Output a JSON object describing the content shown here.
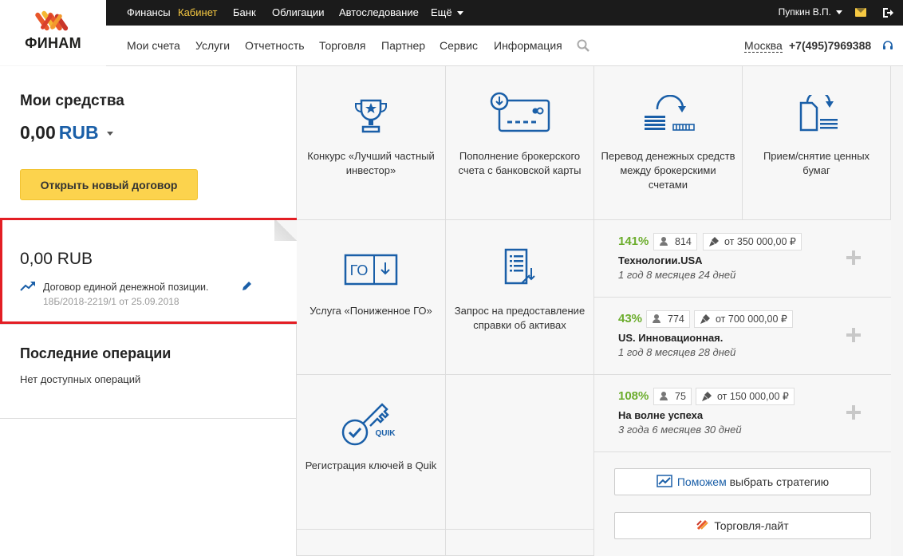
{
  "logo": {
    "text": "ФИНАМ"
  },
  "topbar": {
    "items": [
      "Финансы",
      "Кабинет",
      "Банк",
      "Облигации",
      "Автоследование",
      "Ещё"
    ],
    "user": "Пупкин В.П."
  },
  "mainnav": {
    "items": [
      "Мои счета",
      "Услуги",
      "Отчетность",
      "Торговля",
      "Партнер",
      "Сервис",
      "Информация"
    ],
    "city": "Москва",
    "phone": "+7(495)7969388"
  },
  "funds": {
    "title": "Мои средства",
    "amount": "0,00",
    "currency": "RUB",
    "open_button": "Открыть новый договор"
  },
  "contract": {
    "amount": "0,00 RUB",
    "name": "Договор единой денежной позиции.",
    "number": "18Б/2018-2219/1 от 25.09.2018"
  },
  "operations": {
    "title": "Последние операции",
    "empty": "Нет доступных операций"
  },
  "tiles": {
    "contest": "Конкурс «Лучший частный инвестор»",
    "topup": "Пополнение брокерского счета с банковской карты",
    "transfer": "Перевод денежных средств между брокерскими счетами",
    "securities": "Прием/снятие ценных бумаг",
    "go": "Услуга «Пониженное ГО»",
    "report": "Запрос на предоставление справки об активах",
    "quik": "Регистрация ключей в Quik",
    "go_icon_text": "ГО",
    "quik_icon_text": "QUIK"
  },
  "strategies": [
    {
      "pct": "141%",
      "users": "814",
      "min": "от 350 000,00 ₽",
      "name": "Технологии.USA",
      "duration": "1 год 8 месяцев 24 дней"
    },
    {
      "pct": "43%",
      "users": "774",
      "min": "от 700 000,00 ₽",
      "name": "US. Инновационная.",
      "duration": "1 год 8 месяцев 28 дней"
    },
    {
      "pct": "108%",
      "users": "75",
      "min": "от 150 000,00 ₽",
      "name": "На волне успеха",
      "duration": "3 года 6 месяцев 30 дней"
    }
  ],
  "buttons": {
    "help_highlight": "Поможем",
    "help_rest": " выбрать стратегию",
    "lite": "Торговля-лайт"
  },
  "colors": {
    "accent_yellow": "#fcd34d",
    "brand_blue": "#1a5fa8",
    "positive_green": "#6cad2d",
    "highlight_red": "#e31e24"
  }
}
